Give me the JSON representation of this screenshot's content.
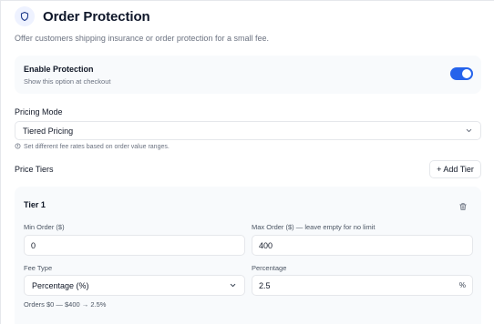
{
  "header": {
    "title": "Order Protection",
    "subtitle": "Offer customers shipping insurance or order protection for a small fee.",
    "icon": "shield-icon"
  },
  "enable_protection": {
    "title": "Enable Protection",
    "description": "Show this option at checkout",
    "enabled": true,
    "accent": "#2563eb"
  },
  "pricing_mode": {
    "label": "Pricing Mode",
    "selected": "Tiered Pricing",
    "hint": "Set different fee rates based on order value ranges."
  },
  "price_tiers": {
    "label": "Price Tiers",
    "add_button": "+ Add Tier",
    "tiers": [
      {
        "title": "Tier 1",
        "min_label": "Min Order ($)",
        "min_value": "0",
        "max_label": "Max Order ($) — leave empty for no limit",
        "max_value": "400",
        "fee_type_label": "Fee Type",
        "fee_type": "Percentage (%)",
        "percentage_label": "Percentage",
        "percentage": "2.5",
        "percentage_suffix": "%",
        "summary": "Orders $0 — $400 → 2.5%"
      }
    ]
  }
}
